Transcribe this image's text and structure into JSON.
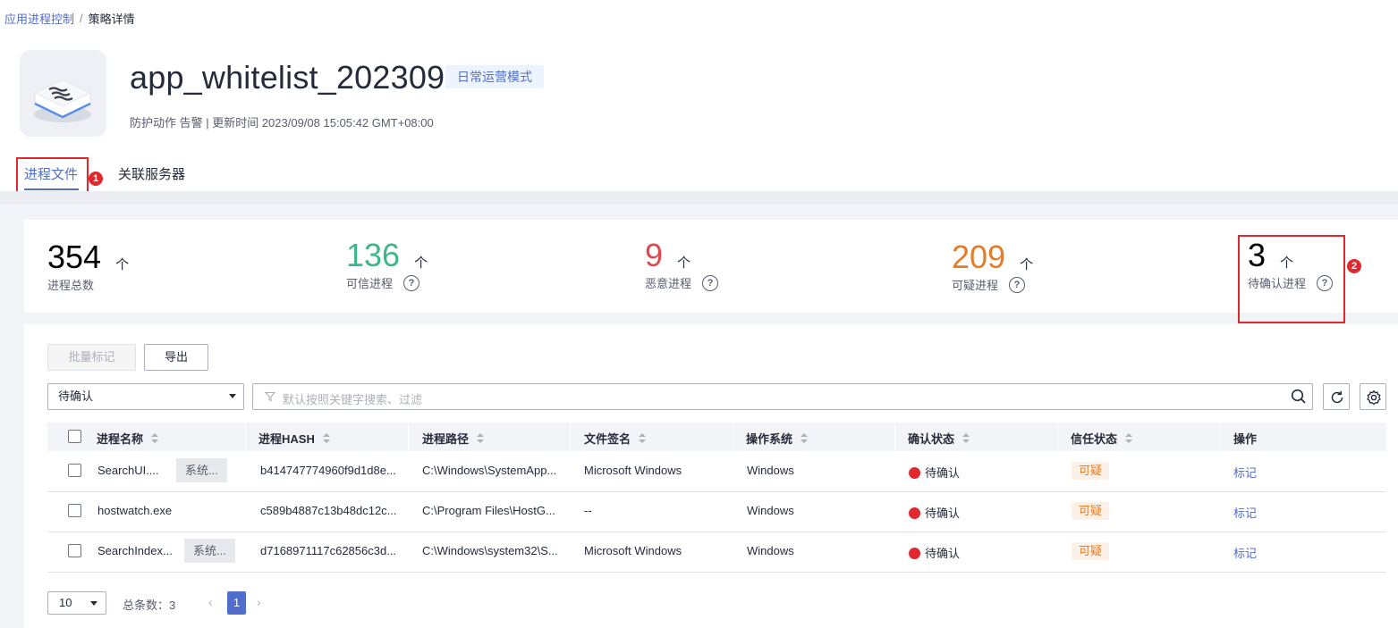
{
  "breadcrumb": {
    "parent": "应用进程控制",
    "separator": "/",
    "current": "策略详情"
  },
  "header": {
    "title": "app_whitelist_202309",
    "mode_tag": "日常运营模式",
    "meta": "防护动作 告警 | 更新时间 2023/09/08 15:05:42 GMT+08:00"
  },
  "tabs": [
    {
      "label": "进程文件",
      "active": true
    },
    {
      "label": "关联服务器",
      "active": false
    }
  ],
  "callouts": [
    "1",
    "2"
  ],
  "stats": [
    {
      "value": "354",
      "unit": "个",
      "label": "进程总数",
      "color": "#252b3a"
    },
    {
      "value": "136",
      "unit": "个",
      "label": "可信进程",
      "color": "#3fb68a",
      "help_icon": "question-circle-icon"
    },
    {
      "value": "9",
      "unit": "个",
      "label": "恶意进程",
      "color": "#e0484e",
      "help_icon": "question-circle-icon"
    },
    {
      "value": "209",
      "unit": "个",
      "label": "可疑进程",
      "color": "#e37d29",
      "help_icon": "question-circle-icon"
    },
    {
      "value": "3",
      "unit": "个",
      "label": "待确认进程",
      "color": "#252b3a",
      "help_icon": "question-circle-icon"
    }
  ],
  "toolbar": {
    "batch_mark_label": "批量标记",
    "export_label": "导出",
    "filter_select_value": "待确认",
    "search_placeholder": "默认按照关键字搜索、过滤"
  },
  "table": {
    "columns": [
      "进程名称",
      "进程HASH",
      "进程路径",
      "文件签名",
      "操作系统",
      "确认状态",
      "信任状态",
      "操作"
    ],
    "rows": [
      {
        "name": "SearchUI....",
        "tag": "系统...",
        "hash": "b414747774960f9d1d8e...",
        "path": "C:\\Windows\\SystemApp...",
        "signature": "Microsoft Windows",
        "os": "Windows",
        "confirm_status": "待确认",
        "trust_status": "可疑",
        "action": "标记"
      },
      {
        "name": "hostwatch.exe",
        "tag": "",
        "hash": "c589b4887c13b48dc12c...",
        "path": "C:\\Program Files\\HostG...",
        "signature": "--",
        "os": "Windows",
        "confirm_status": "待确认",
        "trust_status": "可疑",
        "action": "标记"
      },
      {
        "name": "SearchIndex...",
        "tag": "系统...",
        "hash": "d7168971117c62856c3d...",
        "path": "C:\\Windows\\system32\\S...",
        "signature": "Microsoft Windows",
        "os": "Windows",
        "confirm_status": "待确认",
        "trust_status": "可疑",
        "action": "标记"
      }
    ]
  },
  "pagination": {
    "page_size": "10",
    "total_label": "总条数：3",
    "current_page": "1",
    "prev": "‹",
    "next": "›"
  },
  "colors": {
    "accent": "#526ecc",
    "danger": "#e0282e",
    "warning": "#e37d29",
    "success": "#3fb68a"
  }
}
